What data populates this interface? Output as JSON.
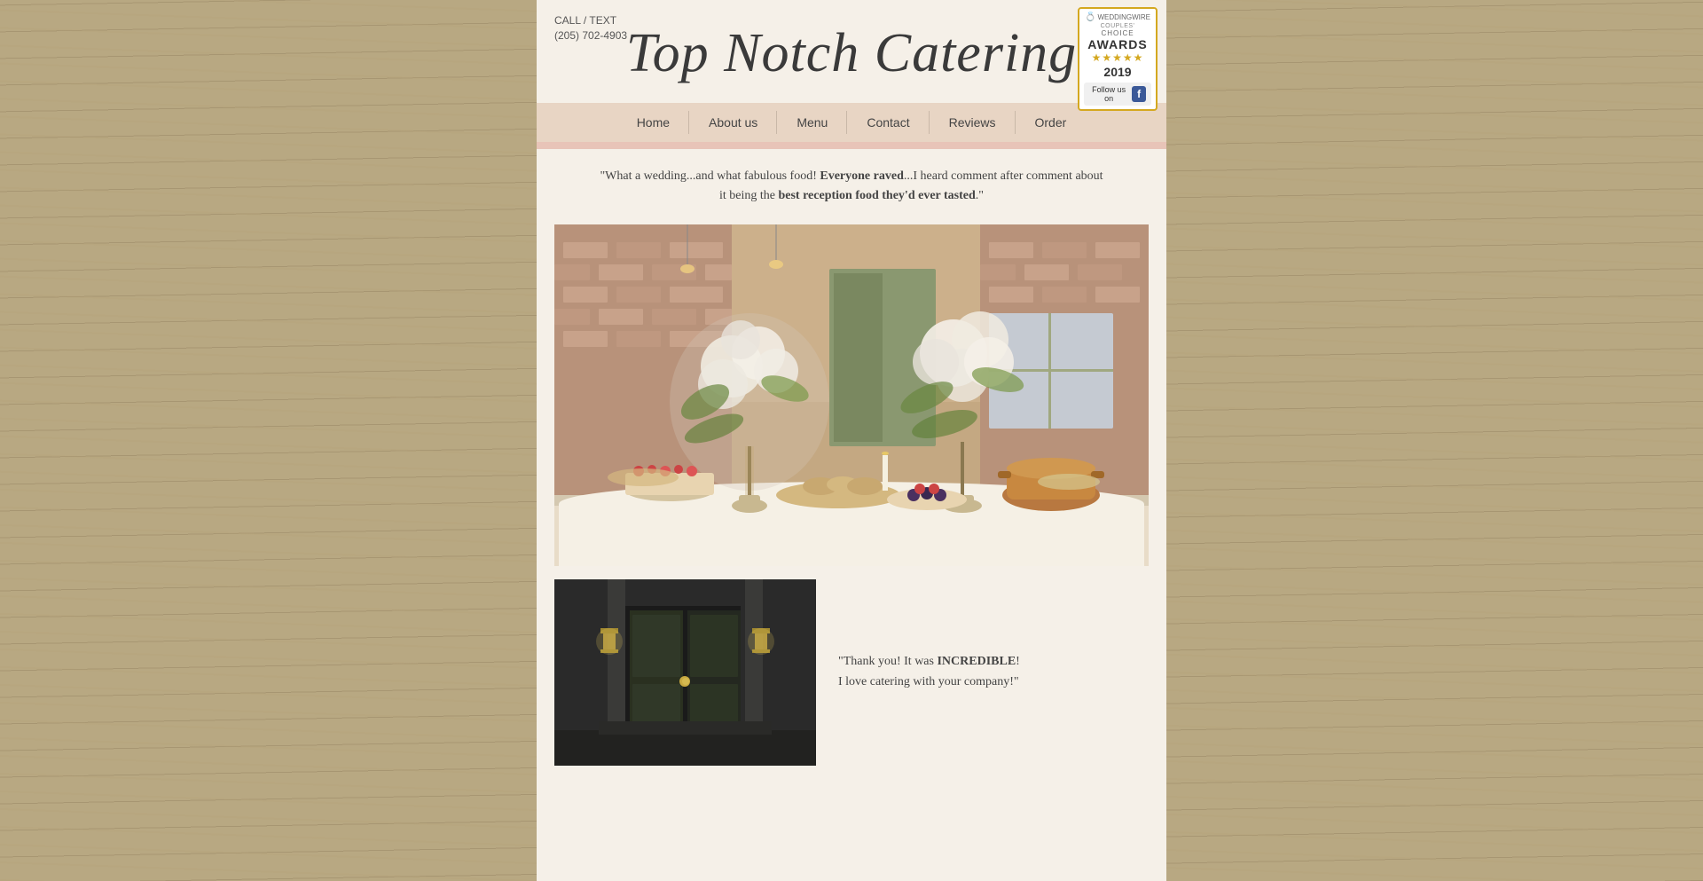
{
  "site": {
    "title": "Top Notch Catering",
    "call_label": "CALL / TEXT",
    "phone": "(205) 702-4903"
  },
  "badge": {
    "logo_text": "WEDDINGWIRE",
    "couples_text": "COUPLES'",
    "choice_text": "CHOICE",
    "awards_text": "AWARDS",
    "stars": "★★★★★",
    "year": "2019",
    "follow_text": "Follow us on"
  },
  "nav": {
    "items": [
      {
        "label": "Home",
        "id": "home"
      },
      {
        "label": "About us",
        "id": "about"
      },
      {
        "label": "Menu",
        "id": "menu"
      },
      {
        "label": "Contact",
        "id": "contact"
      },
      {
        "label": "Reviews",
        "id": "reviews"
      },
      {
        "label": "Order",
        "id": "order"
      }
    ]
  },
  "hero": {
    "quote_part1": "\"What a wedding...and what fabulous food! ",
    "quote_bold": "Everyone raved",
    "quote_part2": "...I heard comment after comment about",
    "quote_line2_pre": "it being the ",
    "quote_bold2": "best reception food they'd ever tasted",
    "quote_line2_post": ".\""
  },
  "second": {
    "quote_pre": "\"Thank you! It was ",
    "quote_bold": "INCREDIBLE",
    "quote_post": "!",
    "quote_line2": "I love catering with your company!\""
  }
}
